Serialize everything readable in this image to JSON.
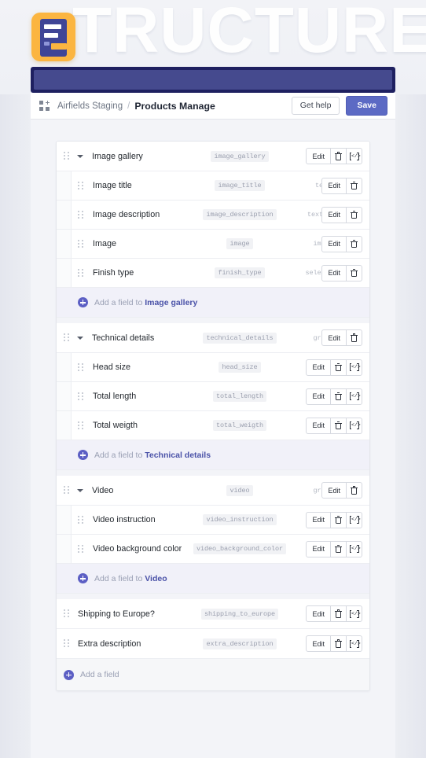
{
  "hero": {
    "ghost_text": "TRUCTURE",
    "logo_icon": "form-document-logo",
    "accent_yellow": "#fbb540",
    "accent_navy": "#3f4596",
    "bar_outer_color": "#1e2060",
    "bar_inner_color": "#454a8e"
  },
  "topbar": {
    "breadcrumb_icon": "grid-add-icon",
    "parent": "Airfields Staging",
    "separator": "/",
    "current": "Products Manage",
    "get_help_label": "Get help",
    "save_label": "Save",
    "save_color": "#5c6ac4"
  },
  "actions": {
    "edit_label": "Edit",
    "delete_icon": "trash-icon",
    "code_icon": "code-brackets-icon"
  },
  "sections": [
    {
      "parent": {
        "label": "Image gallery",
        "slug": "image_gallery",
        "type": "repeater",
        "has_code": true,
        "expanded": true
      },
      "children": [
        {
          "label": "Image title",
          "slug": "image_title",
          "type": "text",
          "has_code": false
        },
        {
          "label": "Image description",
          "slug": "image_description",
          "type": "textarea",
          "has_code": false
        },
        {
          "label": "Image",
          "slug": "image",
          "type": "image",
          "has_code": false
        },
        {
          "label": "Finish type",
          "slug": "finish_type",
          "type": "selection",
          "has_code": false
        }
      ],
      "add_prefix": "Add a field to ",
      "add_target": "Image gallery"
    },
    {
      "parent": {
        "label": "Technical details",
        "slug": "technical_details",
        "type": "group",
        "has_code": false,
        "expanded": true
      },
      "children": [
        {
          "label": "Head size",
          "slug": "head_size",
          "type": "number",
          "has_code": true
        },
        {
          "label": "Total length",
          "slug": "total_length",
          "type": "integer",
          "has_code": true
        },
        {
          "label": "Total weigth",
          "slug": "total_weigth",
          "type": "integer",
          "has_code": true
        }
      ],
      "add_prefix": "Add a field to ",
      "add_target": "Technical details"
    },
    {
      "parent": {
        "label": "Video",
        "slug": "video",
        "type": "group",
        "has_code": false,
        "expanded": true
      },
      "children": [
        {
          "label": "Video instruction",
          "slug": "video_instruction",
          "type": "video",
          "has_code": true
        },
        {
          "label": "Video background color",
          "slug": "video_background_color",
          "type": "color",
          "has_code": true,
          "slug_overflows": true
        }
      ],
      "add_prefix": "Add a field to ",
      "add_target": "Video"
    }
  ],
  "top_level_fields": [
    {
      "label": "Shipping to Europe?",
      "slug": "shipping_to_europe",
      "type": "boolean",
      "has_code": true
    },
    {
      "label": "Extra description",
      "slug": "extra_description",
      "type": "wysiwyg",
      "has_code": true
    }
  ],
  "footer": {
    "add_field_label": "Add a field"
  }
}
